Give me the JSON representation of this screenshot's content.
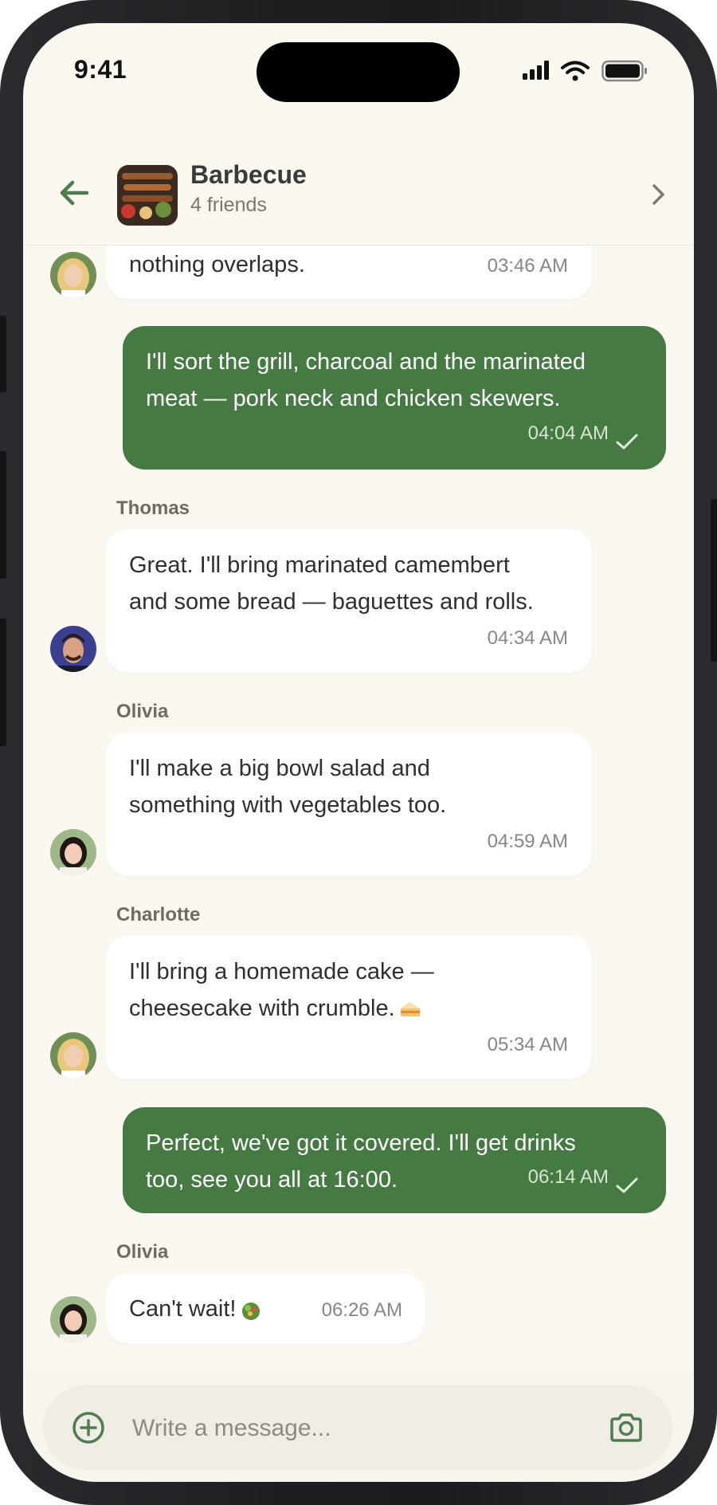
{
  "status_bar": {
    "time": "9:41"
  },
  "header": {
    "title": "Barbecue",
    "subtitle": "4 friends",
    "back_icon": "arrow-left-icon",
    "forward_icon": "chevron-right-icon"
  },
  "messages": [
    {
      "direction": "in",
      "sender": "",
      "avatar": "charlotte",
      "text": "Yes! Let's split who brings what so\nnothing overlaps.",
      "time": "03:46 AM"
    },
    {
      "direction": "out",
      "text": "I'll sort the grill, charcoal and the marinated\nmeat — pork neck and chicken skewers.",
      "time": "04:04 AM",
      "status": "sent"
    },
    {
      "direction": "in",
      "sender": "Thomas",
      "avatar": "thomas",
      "text": "Great. I'll bring marinated camembert\nand some bread — baguettes and rolls.",
      "time": "04:34 AM"
    },
    {
      "direction": "in",
      "sender": "Olivia",
      "avatar": "olivia",
      "text": "I'll make a big bowl salad and\nsomething with vegetables too.",
      "time": "04:59 AM"
    },
    {
      "direction": "in",
      "sender": "Charlotte",
      "avatar": "charlotte",
      "text": "I'll bring a homemade cake —\ncheesecake with crumble.",
      "emoji": "cake-icon",
      "time": "05:34 AM"
    },
    {
      "direction": "out",
      "text": "Perfect, we've got it covered. I'll get drinks\ntoo, see you all at 16:00.",
      "time": "06:14 AM",
      "status": "sent"
    },
    {
      "direction": "in",
      "sender": "Olivia",
      "avatar": "olivia",
      "text": "Can't wait!",
      "emoji": "salad-icon",
      "time": "06:26 AM"
    }
  ],
  "composer": {
    "placeholder": "Write a message...",
    "add_icon": "plus-circle-icon",
    "camera_icon": "camera-icon"
  },
  "colors": {
    "background": "#fbf8f2",
    "outgoing_bubble": "#457a43",
    "incoming_bubble": "#ffffff",
    "accent": "#457a43"
  }
}
